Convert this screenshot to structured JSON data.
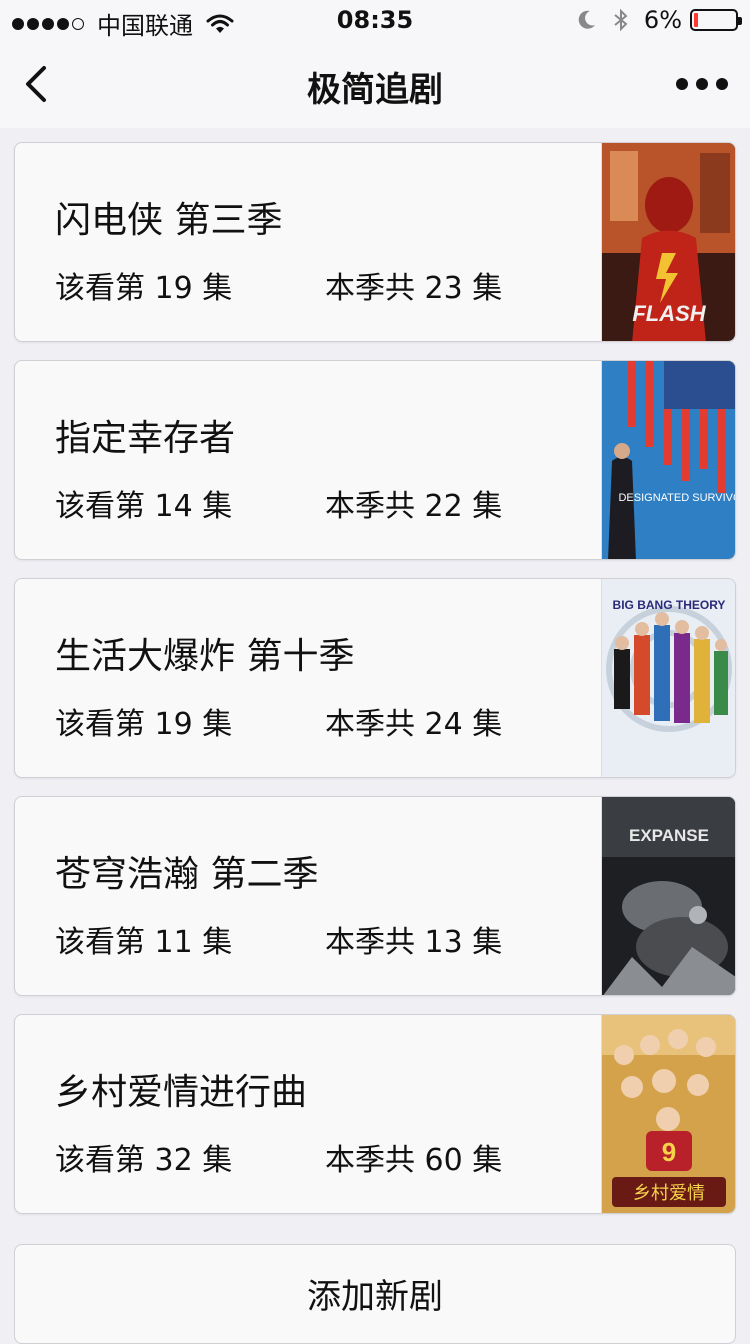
{
  "status_bar": {
    "carrier": "中国联通",
    "time": "08:35",
    "battery": "6%"
  },
  "nav": {
    "title": "极简追剧"
  },
  "shows": [
    {
      "title": "闪电侠 第三季",
      "watch": "该看第 19 集",
      "total": "本季共 23 集",
      "poster_text": "FLASH"
    },
    {
      "title": "指定幸存者",
      "watch": "该看第 14 集",
      "total": "本季共 22 集",
      "poster_text": "DESIGNATED SURVIVOR"
    },
    {
      "title": "生活大爆炸 第十季",
      "watch": "该看第 19 集",
      "total": "本季共 24 集",
      "poster_text": "BIG BANG THEORY"
    },
    {
      "title": "苍穹浩瀚 第二季",
      "watch": "该看第 11 集",
      "total": "本季共 13 集",
      "poster_text": "EXPANSE"
    },
    {
      "title": "乡村爱情进行曲",
      "watch": "该看第 32 集",
      "total": "本季共 60 集",
      "poster_text": "乡村爱情"
    }
  ],
  "add_button": "添加新剧"
}
